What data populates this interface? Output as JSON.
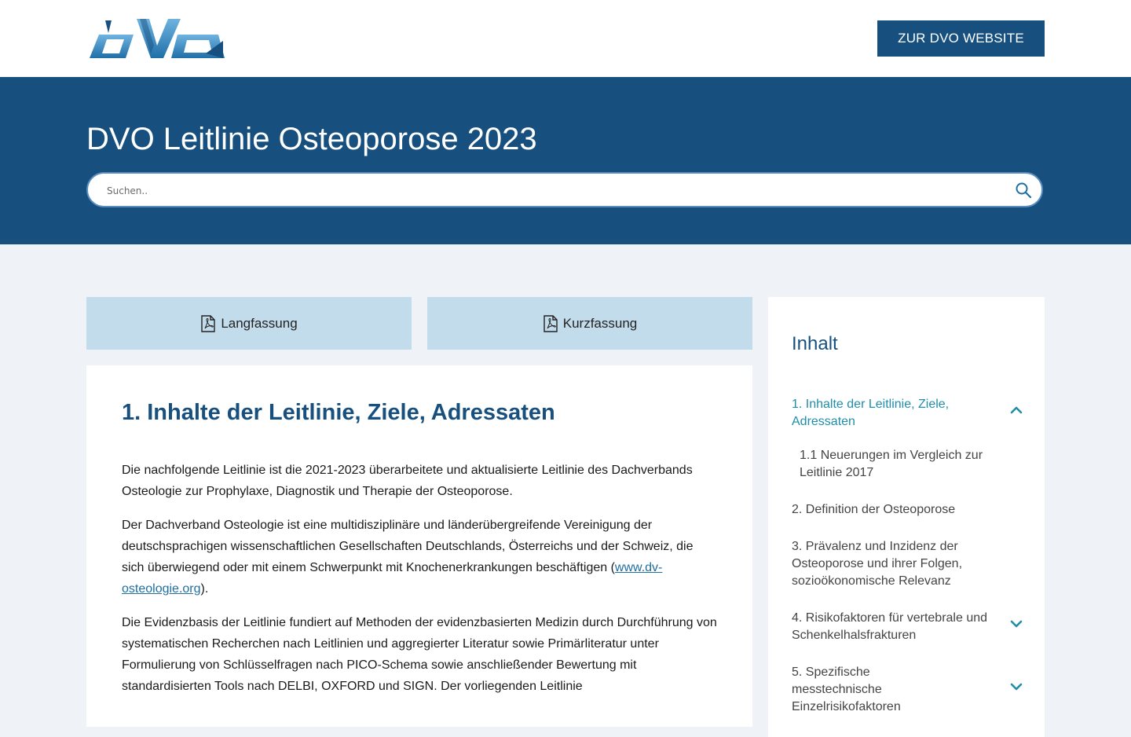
{
  "header": {
    "logo_alt": "DVO",
    "site_button_label": "ZUR DVO WEBSITE"
  },
  "hero": {
    "title": "DVO Leitlinie Osteoporose 2023",
    "search_placeholder": "Suchen.."
  },
  "downloads": {
    "lang_label": "Langfassung",
    "kurz_label": "Kurzfassung"
  },
  "content": {
    "heading": "1. Inhalte der Leitlinie, Ziele, Adressaten",
    "p1": "Die nachfolgende Leitlinie ist die 2021-2023 überarbeitete und aktualisierte Leitlinie des Dachverbands Osteologie zur Prophylaxe, Diagnostik und Therapie der Osteoporose.",
    "p2_before": "Der Dachverband Osteologie ist eine multidisziplinäre und länderübergreifende Vereinigung der deutschsprachigen wissenschaftlichen Gesellschaften Deutschlands, Österreichs und der Schweiz, die sich überwiegend oder mit einem Schwerpunkt mit Knochenerkrankungen beschäftigen (",
    "p2_link": "www.dv-osteologie.org",
    "p2_after": ").",
    "p3": "Die Evidenzbasis der Leitlinie fundiert auf Methoden der evidenzbasierten Medizin durch Durchführung von systematischen Recherchen nach Leitlinien und aggregierter Literatur sowie Primärliteratur unter Formulierung von Schlüsselfragen nach PICO-Schema sowie anschließender Bewertung mit standardisierten Tools nach DELBI, OXFORD und SIGN. Der vorliegenden Leitlinie"
  },
  "toc": {
    "title": "Inhalt",
    "items": [
      {
        "label": "1. Inhalte der Leitlinie, Ziele, Adressaten",
        "state": "expanded"
      },
      {
        "label": "1.1 Neuerungen im Vergleich zur Leitlinie 2017",
        "state": "sub"
      },
      {
        "label": "2. Definition der Osteoporose",
        "state": "none"
      },
      {
        "label": "3. Prävalenz und Inzidenz der Osteoporose und ihrer Folgen, sozioökonomische Relevanz",
        "state": "none"
      },
      {
        "label": "4. Risikofaktoren für vertebrale und Schenkelhalsfrakturen",
        "state": "collapsed"
      },
      {
        "label": "5. Spezifische messtechnische Einzelrisikofaktoren",
        "state": "collapsed"
      }
    ]
  },
  "colors": {
    "brand": "#17507e",
    "accent": "#1f8ea8",
    "button_bg": "#c3dcec",
    "page_bg": "#eff3f8"
  }
}
